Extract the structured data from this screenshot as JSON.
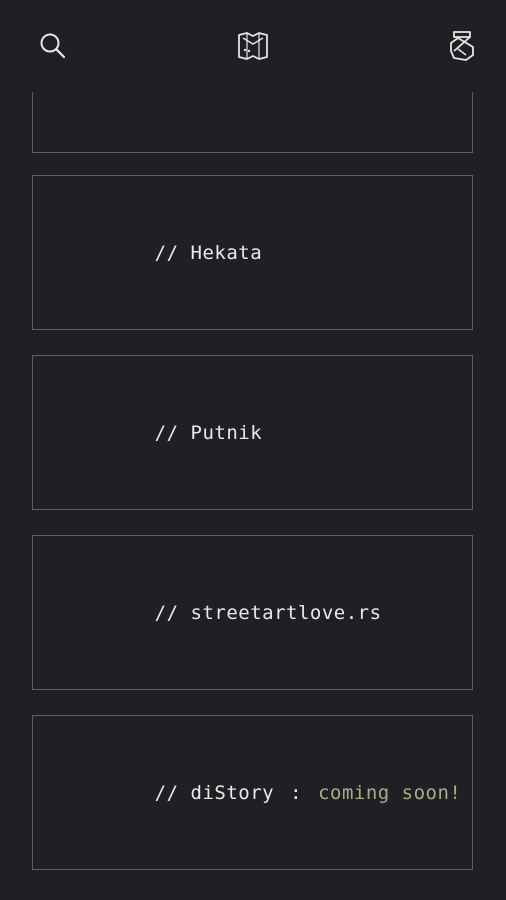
{
  "toolbar": {
    "search_icon": "search-icon",
    "map_icon": "map-icon",
    "logo_icon": "brand-logo-icon"
  },
  "cards": [
    {
      "prefix": "",
      "label": ""
    },
    {
      "prefix": "//",
      "label": "Hekata"
    },
    {
      "prefix": "//",
      "label": "Putnik"
    },
    {
      "prefix": "//",
      "label": "streetartlove.rs"
    },
    {
      "prefix": "//",
      "label": "diStory",
      "separator": ":",
      "status": "coming soon!"
    }
  ],
  "colors": {
    "background": "#1f2023",
    "border": "#5c5e63",
    "text": "#e9e9e9",
    "highlight": "#a7ad84"
  }
}
